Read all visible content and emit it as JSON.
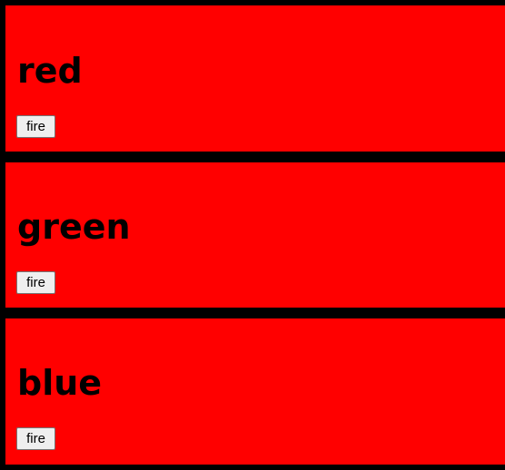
{
  "colors": {
    "page_background": "#000000",
    "panel_background": "#ff0000",
    "title_text": "#000000",
    "button_background": "#efefef",
    "button_border": "#767676"
  },
  "panels": [
    {
      "title": "red",
      "button_label": "fire"
    },
    {
      "title": "green",
      "button_label": "fire"
    },
    {
      "title": "blue",
      "button_label": "fire"
    }
  ]
}
